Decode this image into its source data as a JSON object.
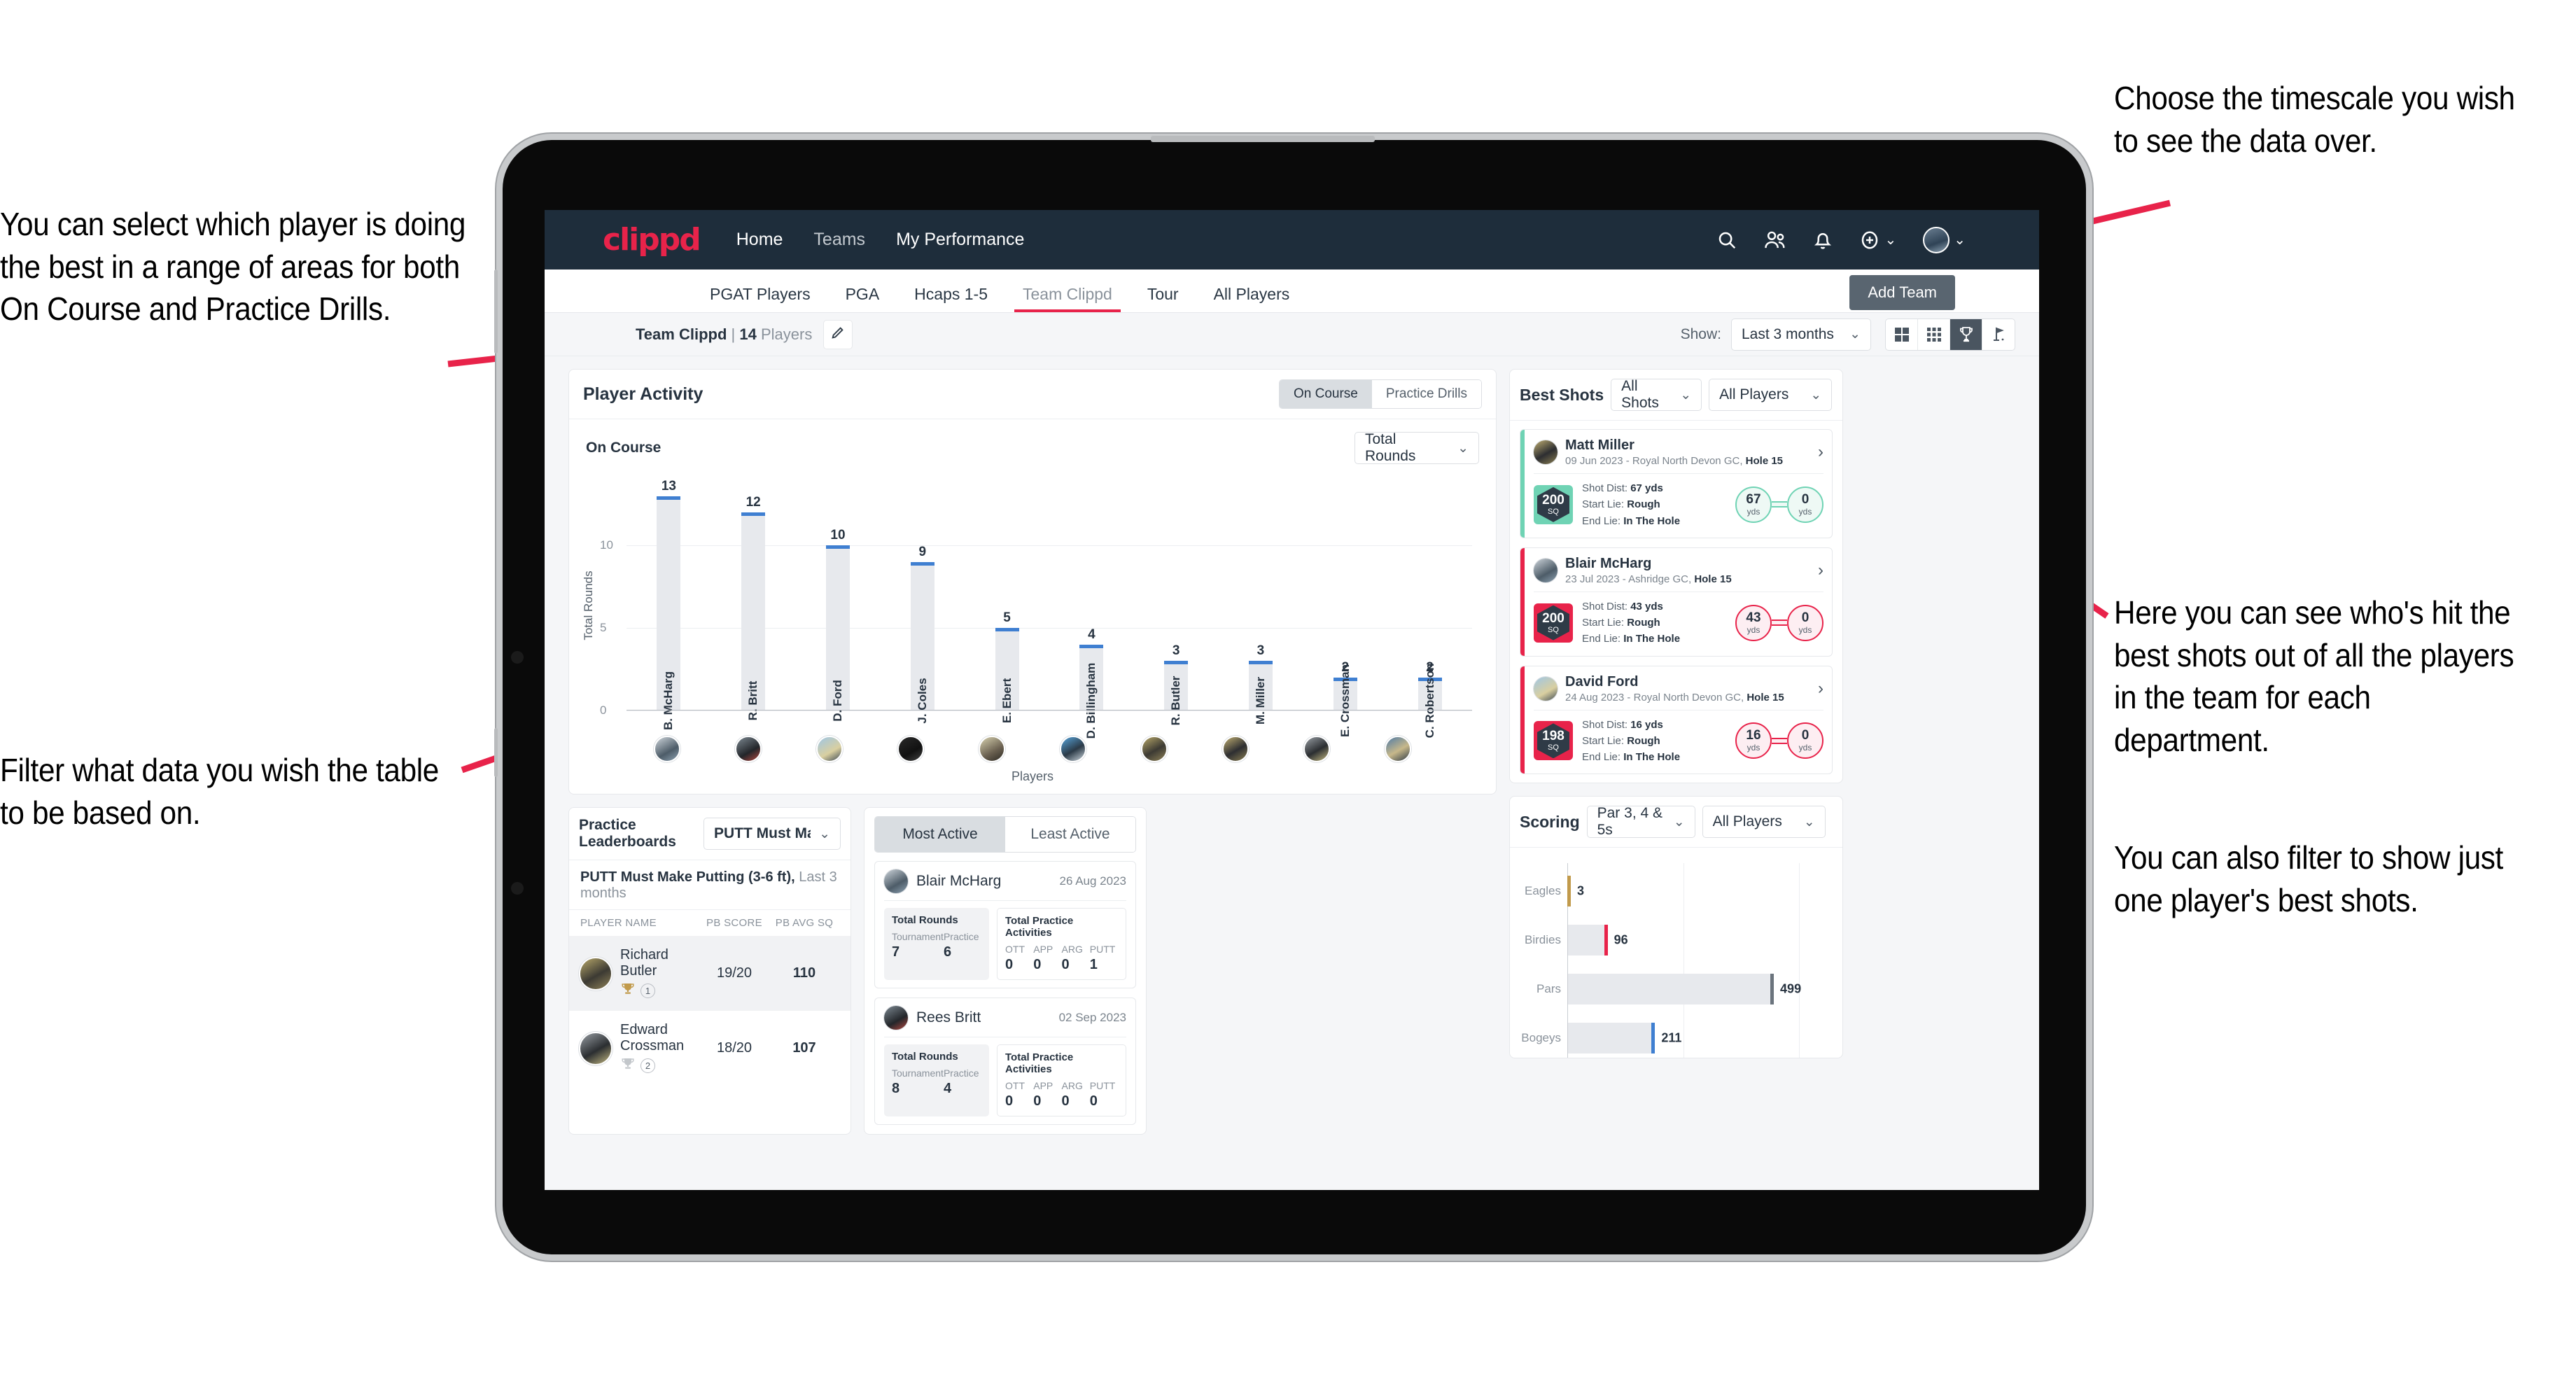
{
  "annotations": {
    "left_top": "You can select which player is doing the best in a range of areas for both On Course and Practice Drills.",
    "left_bottom": "Filter what data you wish the table to be based on.",
    "right_top": "Choose the timescale you wish to see the data over.",
    "right_mid": "Here you can see who's hit the best shots out of all the players in the team for each department.",
    "right_bottom": "You can also filter to show just one player's best shots."
  },
  "colors": {
    "brand_pink": "#e8234a",
    "navy": "#1e2d3b",
    "bar_blue": "#3f7fd1",
    "teal": "#6fd3b4",
    "gold": "#c19a4b"
  },
  "topnav": {
    "logo": "clippd",
    "links": [
      {
        "label": "Home",
        "dim": false
      },
      {
        "label": "Teams",
        "dim": true
      },
      {
        "label": "My Performance",
        "dim": false
      }
    ],
    "icons": [
      "search-icon",
      "people-icon",
      "bell-icon",
      "plus-circle-icon",
      "avatar"
    ]
  },
  "tabs": [
    {
      "label": "PGAT Players",
      "active": false
    },
    {
      "label": "PGA",
      "active": false
    },
    {
      "label": "Hcaps 1-5",
      "active": false
    },
    {
      "label": "Team Clippd",
      "active": true
    },
    {
      "label": "Tour",
      "active": false
    },
    {
      "label": "All Players",
      "active": false
    }
  ],
  "add_team_tooltip": "Add Team",
  "subheader": {
    "team_name": "Team Clippd",
    "separator": "|",
    "player_count": "14",
    "players_word": "Players",
    "edit_icon": "pencil-icon",
    "show_label": "Show:",
    "timescale_value": "Last 3 months",
    "view_toggles": [
      {
        "icon": "grid-2x2-icon",
        "active": false
      },
      {
        "icon": "grid-3x3-icon",
        "active": false
      },
      {
        "icon": "trophy-icon",
        "active": true
      },
      {
        "icon": "golf-flag-icon",
        "active": false
      }
    ]
  },
  "player_activity": {
    "title": "Player Activity",
    "segments": [
      {
        "label": "On Course",
        "active": true
      },
      {
        "label": "Practice Drills",
        "active": false
      }
    ],
    "sub_label": "On Course",
    "metric_value": "Total Rounds"
  },
  "chart_data": [
    {
      "type": "bar",
      "title": "Player Activity - On Course",
      "xlabel": "Players",
      "ylabel": "Total Rounds",
      "ylim": [
        0,
        14
      ],
      "yticks": [
        0,
        5,
        10
      ],
      "grid": true,
      "categories": [
        "B. McHarg",
        "R. Britt",
        "D. Ford",
        "J. Coles",
        "E. Ebert",
        "D. Billingham",
        "R. Butler",
        "M. Miller",
        "E. Crossman",
        "C. Robertson"
      ],
      "values": [
        13,
        12,
        10,
        9,
        5,
        4,
        3,
        3,
        2,
        2
      ]
    },
    {
      "type": "bar",
      "orientation": "horizontal",
      "title": "Scoring",
      "categories": [
        "Eagles",
        "Birdies",
        "Pars",
        "Bogeys"
      ],
      "values": [
        3,
        96,
        499,
        211
      ],
      "xlim": [
        0,
        560
      ],
      "grid": true,
      "colors": [
        "#c19a4b",
        "#e8234a",
        "#6b747d",
        "#3f7fd1"
      ]
    }
  ],
  "best_shots": {
    "title": "Best Shots",
    "filter_shots": "All Shots",
    "filter_players": "All Players",
    "shots": [
      {
        "player": "Matt Miller",
        "meta_date": "09 Jun 2023",
        "meta_course": "Royal North Devon GC,",
        "meta_hole": "Hole 15",
        "badge_value": "200",
        "badge_unit": "SQ",
        "accent": "#6fd3b4",
        "shot_dist_label": "Shot Dist:",
        "shot_dist_value": "67 yds",
        "start_lie_label": "Start Lie:",
        "start_lie_value": "Rough",
        "end_lie_label": "End Lie:",
        "end_lie_value": "In The Hole",
        "from_value": "67",
        "from_unit": "yds",
        "to_value": "0",
        "to_unit": "yds"
      },
      {
        "player": "Blair McHarg",
        "meta_date": "23 Jul 2023",
        "meta_course": "Ashridge GC,",
        "meta_hole": "Hole 15",
        "badge_value": "200",
        "badge_unit": "SQ",
        "accent": "#e8234a",
        "shot_dist_label": "Shot Dist:",
        "shot_dist_value": "43 yds",
        "start_lie_label": "Start Lie:",
        "start_lie_value": "Rough",
        "end_lie_label": "End Lie:",
        "end_lie_value": "In The Hole",
        "from_value": "43",
        "from_unit": "yds",
        "to_value": "0",
        "to_unit": "yds"
      },
      {
        "player": "David Ford",
        "meta_date": "24 Aug 2023",
        "meta_course": "Royal North Devon GC,",
        "meta_hole": "Hole 15",
        "badge_value": "198",
        "badge_unit": "SQ",
        "accent": "#e8234a",
        "shot_dist_label": "Shot Dist:",
        "shot_dist_value": "16 yds",
        "start_lie_label": "Start Lie:",
        "start_lie_value": "Rough",
        "end_lie_label": "End Lie:",
        "end_lie_value": "In The Hole",
        "from_value": "16",
        "from_unit": "yds",
        "to_value": "0",
        "to_unit": "yds"
      }
    ]
  },
  "practice_leaderboards": {
    "title": "Practice Leaderboards",
    "drill_select": "PUTT Must Make Putting ...",
    "sub_title": "PUTT Must Make Putting (3-6 ft),",
    "sub_period": "Last 3 months",
    "columns": [
      "PLAYER NAME",
      "PB SCORE",
      "PB AVG SQ"
    ],
    "rows": [
      {
        "name": "Richard Butler",
        "rank": "1",
        "trophy": "gold",
        "pb_score": "19/20",
        "pb_avg_sq": "110"
      },
      {
        "name": "Edward Crossman",
        "rank": "2",
        "trophy": "silver",
        "pb_score": "18/20",
        "pb_avg_sq": "107"
      }
    ]
  },
  "activity_panel": {
    "tabs": [
      {
        "label": "Most Active",
        "active": true
      },
      {
        "label": "Least Active",
        "active": false
      }
    ],
    "items": [
      {
        "name": "Blair McHarg",
        "date": "26 Aug 2023",
        "rounds_title": "Total Rounds",
        "rounds": [
          {
            "key": "Tournament",
            "value": "7"
          },
          {
            "key": "Practice",
            "value": "6"
          }
        ],
        "practice_title": "Total Practice Activities",
        "practice": [
          {
            "key": "OTT",
            "value": "0"
          },
          {
            "key": "APP",
            "value": "0"
          },
          {
            "key": "ARG",
            "value": "0"
          },
          {
            "key": "PUTT",
            "value": "1"
          }
        ]
      },
      {
        "name": "Rees Britt",
        "date": "02 Sep 2023",
        "rounds_title": "Total Rounds",
        "rounds": [
          {
            "key": "Tournament",
            "value": "8"
          },
          {
            "key": "Practice",
            "value": "4"
          }
        ],
        "practice_title": "Total Practice Activities",
        "practice": [
          {
            "key": "OTT",
            "value": "0"
          },
          {
            "key": "APP",
            "value": "0"
          },
          {
            "key": "ARG",
            "value": "0"
          },
          {
            "key": "PUTT",
            "value": "0"
          }
        ]
      }
    ]
  },
  "scoring": {
    "title": "Scoring",
    "filter_par": "Par 3, 4 & 5s",
    "filter_players": "All Players",
    "rows": [
      {
        "label": "Eagles",
        "value": "3"
      },
      {
        "label": "Birdies",
        "value": "96"
      },
      {
        "label": "Pars",
        "value": "499"
      },
      {
        "label": "Bogeys",
        "value": "211"
      }
    ]
  }
}
